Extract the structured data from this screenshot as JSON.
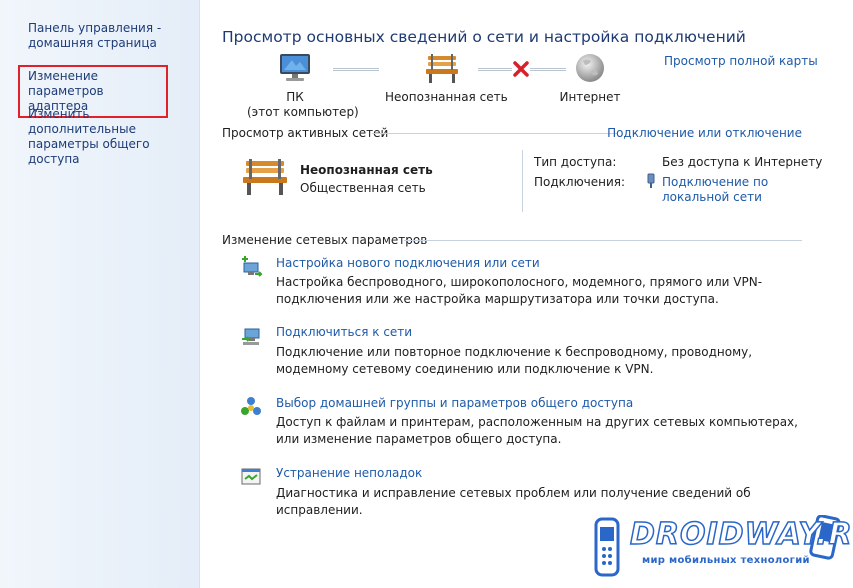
{
  "sidebar": {
    "items": [
      {
        "label": "Панель управления - домашняя страница"
      },
      {
        "label": "Изменение параметров адаптера"
      },
      {
        "label": "Изменить дополнительные параметры общего доступа"
      }
    ]
  },
  "header": {
    "title": "Просмотр основных сведений о сети и настройка подключений",
    "full_map_link": "Просмотр полной карты"
  },
  "map": {
    "pc_label": "ПК",
    "pc_sublabel": "(этот компьютер)",
    "network_label": "Неопознанная сеть",
    "internet_label": "Интернет"
  },
  "active_networks": {
    "heading": "Просмотр активных сетей",
    "connect_link": "Подключение или отключение",
    "network_name": "Неопознанная сеть",
    "network_type": "Общественная сеть",
    "access_label": "Тип доступа:",
    "access_value": "Без доступа к Интернету",
    "connections_label": "Подключения:",
    "connections_value": "Подключение по локальной сети"
  },
  "change_settings": {
    "heading": "Изменение сетевых параметров",
    "tasks": [
      {
        "icon": "new-connection-icon",
        "link": "Настройка нового подключения или сети",
        "desc": "Настройка беспроводного, широкополосного, модемного, прямого или VPN-подключения или же настройка маршрутизатора или точки доступа."
      },
      {
        "icon": "connect-network-icon",
        "link": "Подключиться к сети",
        "desc": "Подключение или повторное подключение к беспроводному, проводному, модемному сетевому соединению или подключение к VPN."
      },
      {
        "icon": "homegroup-icon",
        "link": "Выбор домашней группы и параметров общего доступа",
        "desc": "Доступ к файлам и принтерам, расположенным на других сетевых компьютерах, или изменение параметров общего доступа."
      },
      {
        "icon": "troubleshoot-icon",
        "link": "Устранение неполадок",
        "desc": "Диагностика и исправление сетевых проблем или получение сведений об исправлении."
      }
    ]
  },
  "watermark": {
    "brand": "DROIDWAY.RU",
    "tagline": "мир мобильных технологий"
  },
  "colors": {
    "link": "#1e5aa8",
    "title": "#1e3a72",
    "highlight_box": "#e0202a",
    "error_x": "#d8202a"
  }
}
